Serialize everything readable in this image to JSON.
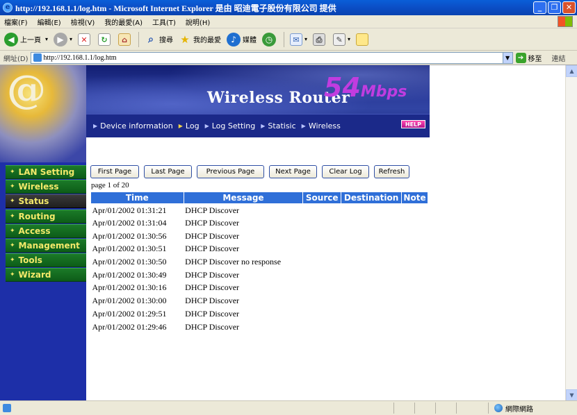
{
  "window": {
    "title": "http://192.168.1.1/log.htm - Microsoft Internet Explorer 是由 昭迪電子股份有限公司 提供",
    "controls": [
      "_",
      "❐",
      "✕"
    ]
  },
  "menu": [
    "檔案(F)",
    "編輯(E)",
    "檢視(V)",
    "我的最愛(A)",
    "工具(T)",
    "說明(H)"
  ],
  "toolbar": {
    "back_label": "上一頁",
    "search_label": "搜尋",
    "favorites_label": "我的最愛",
    "media_label": "媒體"
  },
  "address": {
    "label": "網址(D)",
    "url": "http://192.168.1.1/log.htm",
    "go_label": "移至",
    "links_label": "連結"
  },
  "sidebar": {
    "items": [
      {
        "label": "LAN Setting"
      },
      {
        "label": "Wireless"
      },
      {
        "label": "Status"
      },
      {
        "label": "Routing"
      },
      {
        "label": "Access"
      },
      {
        "label": "Management"
      },
      {
        "label": "Tools"
      },
      {
        "label": "Wizard"
      }
    ],
    "active": "Status"
  },
  "banner": {
    "title_line": "Wireless Router",
    "speed": "54",
    "speed_unit": "Mbps",
    "help_label": "HELP",
    "nav": [
      {
        "label": "Device information"
      },
      {
        "label": "Log"
      },
      {
        "label": "Log Setting"
      },
      {
        "label": "Statisic"
      },
      {
        "label": "Wireless"
      }
    ]
  },
  "buttons": {
    "first": "First Page",
    "last": "Last Page",
    "previous": "Previous Page",
    "next": "Next Page",
    "clear": "Clear Log",
    "refresh": "Refresh"
  },
  "page_info": "page 1 of 20",
  "log": {
    "columns": [
      "Time",
      "Message",
      "Source",
      "Destination",
      "Note"
    ],
    "rows": [
      {
        "time": "Apr/01/2002 01:31:21",
        "message": "DHCP Discover"
      },
      {
        "time": "Apr/01/2002 01:31:04",
        "message": "DHCP Discover"
      },
      {
        "time": "Apr/01/2002 01:30:56",
        "message": "DHCP Discover"
      },
      {
        "time": "Apr/01/2002 01:30:51",
        "message": "DHCP Discover"
      },
      {
        "time": "Apr/01/2002 01:30:50",
        "message": "DHCP Discover no response"
      },
      {
        "time": "Apr/01/2002 01:30:49",
        "message": "DHCP Discover"
      },
      {
        "time": "Apr/01/2002 01:30:16",
        "message": "DHCP Discover"
      },
      {
        "time": "Apr/01/2002 01:30:00",
        "message": "DHCP Discover"
      },
      {
        "time": "Apr/01/2002 01:29:51",
        "message": "DHCP Discover"
      },
      {
        "time": "Apr/01/2002 01:29:46",
        "message": "DHCP Discover"
      }
    ]
  },
  "status": {
    "zone": "網際網路"
  },
  "colors": {
    "accent_blue": "#2f6fd8",
    "sidebar_bg": "#1d2fa8",
    "nav_green": "#1b7a28",
    "nav_text": "#f4e96a",
    "speed_magenta": "#c13ce0"
  }
}
